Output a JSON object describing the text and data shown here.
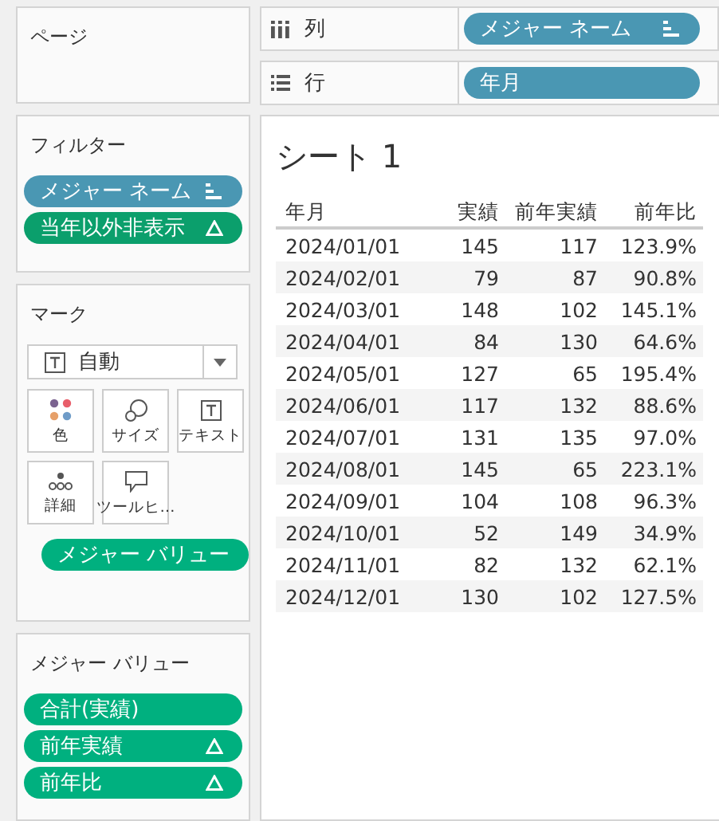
{
  "pages_card": {
    "title": "ページ"
  },
  "filters_card": {
    "title": "フィルター",
    "pills": [
      {
        "label": "メジャー ネーム",
        "kind": "sorted"
      },
      {
        "label": "当年以外非表示",
        "kind": "calcfilter"
      }
    ]
  },
  "marks_card": {
    "title": "マーク",
    "mark_type": "自動",
    "buttons": [
      {
        "label": "色",
        "kind": "color"
      },
      {
        "label": "サイズ",
        "kind": "size"
      },
      {
        "label": "テキスト",
        "kind": "text"
      },
      {
        "label": "詳細",
        "kind": "detail"
      },
      {
        "label": "ツールヒ…",
        "kind": "tooltip"
      }
    ],
    "fields": [
      {
        "label": "メジャー バリュー",
        "kind": "text"
      }
    ]
  },
  "measure_values_card": {
    "title": "メジャー バリュー",
    "pills": [
      {
        "label": "合計(実績)",
        "kind": "measure"
      },
      {
        "label": "前年実績",
        "kind": "calc"
      },
      {
        "label": "前年比",
        "kind": "calc"
      }
    ]
  },
  "columns_shelf": {
    "label": "列",
    "kind": "columns",
    "pills": [
      {
        "label": "メジャー ネーム",
        "kind": "sorted"
      }
    ]
  },
  "rows_shelf": {
    "label": "行",
    "kind": "rows",
    "pills": [
      {
        "label": "年月",
        "kind": "dimension"
      }
    ]
  },
  "sheet": {
    "title": "シート 1",
    "columns": [
      "年月",
      "実績",
      "前年実績",
      "前年比"
    ],
    "rows": [
      [
        "2024/01/01",
        "145",
        "117",
        "123.9%"
      ],
      [
        "2024/02/01",
        "79",
        "87",
        "90.8%"
      ],
      [
        "2024/03/01",
        "148",
        "102",
        "145.1%"
      ],
      [
        "2024/04/01",
        "84",
        "130",
        "64.6%"
      ],
      [
        "2024/05/01",
        "127",
        "65",
        "195.4%"
      ],
      [
        "2024/06/01",
        "117",
        "132",
        "88.6%"
      ],
      [
        "2024/07/01",
        "131",
        "135",
        "97.0%"
      ],
      [
        "2024/08/01",
        "145",
        "65",
        "223.1%"
      ],
      [
        "2024/09/01",
        "104",
        "108",
        "96.3%"
      ],
      [
        "2024/10/01",
        "52",
        "149",
        "34.9%"
      ],
      [
        "2024/11/01",
        "82",
        "132",
        "62.1%"
      ],
      [
        "2024/12/01",
        "130",
        "102",
        "127.5%"
      ]
    ]
  }
}
